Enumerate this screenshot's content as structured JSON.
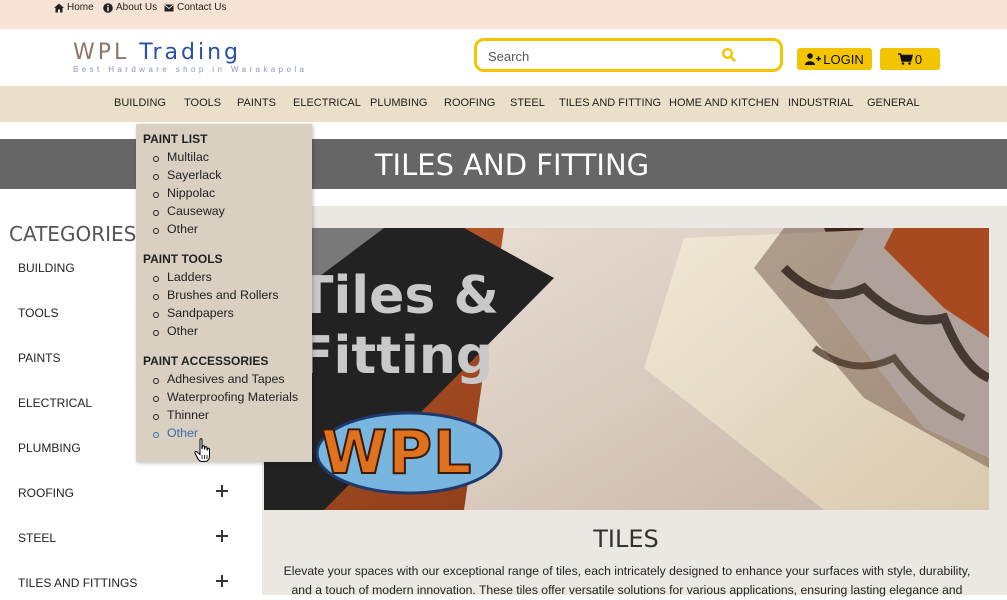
{
  "topbar": {
    "links": [
      {
        "label": "Home",
        "icon": "home-icon"
      },
      {
        "label": "About Us",
        "icon": "info-icon"
      },
      {
        "label": "Contact Us",
        "icon": "envelope-icon"
      }
    ]
  },
  "header": {
    "logo_word1": "WPL",
    "logo_word2": "Trading",
    "logo_tagline": "Best Hardware shop in Warakapola",
    "search_placeholder": "Search",
    "login_label": "LOGIN",
    "cart_count": "0"
  },
  "nav": {
    "items": [
      "BUILDING",
      "TOOLS",
      "PAINTS",
      "ELECTRICAL",
      "PLUMBING",
      "ROOFING",
      "STEEL",
      "TILES AND FITTING",
      "HOME AND KITCHEN",
      "INDUSTRIAL",
      "GENERAL"
    ]
  },
  "dropdown": {
    "sections": [
      {
        "heading": "PAINT LIST",
        "items": [
          "Multilac",
          "Sayerlack",
          "Nippolac",
          "Causeway",
          "Other"
        ]
      },
      {
        "heading": "PAINT TOOLS",
        "items": [
          "Ladders",
          "Brushes and Rollers",
          "Sandpapers",
          "Other"
        ]
      },
      {
        "heading": "PAINT ACCESSORIES",
        "items": [
          "Adhesives and Tapes",
          "Waterproofing Materials",
          "Thinner",
          "Other"
        ]
      }
    ]
  },
  "page": {
    "banner_title": "TILES AND FITTING",
    "hero_line1": "Tiles &",
    "hero_line2": "Fitting",
    "hero_logo": "WPL",
    "section_title": "TILES",
    "description_line1": "Elevate your spaces with our exceptional range of tiles, each intricately designed to enhance your surfaces with style, durability,",
    "description_line2": "and a touch of modern innovation. These tiles offer versatile solutions for various applications, ensuring lasting elegance and"
  },
  "sidebar": {
    "title": "CATEGORIES",
    "items": [
      "BUILDING",
      "TOOLS",
      "PAINTS",
      "ELECTRICAL",
      "PLUMBING",
      "ROOFING",
      "STEEL",
      "TILES AND FITTINGS"
    ]
  },
  "colors": {
    "topbar_bg": "#f6e3d5",
    "nav_bg": "#ecdfc9",
    "accent_yellow": "#f2c500",
    "banner_bg": "#666666",
    "dropdown_bg": "#d9d0c1",
    "active_link": "#3a6aa8"
  }
}
